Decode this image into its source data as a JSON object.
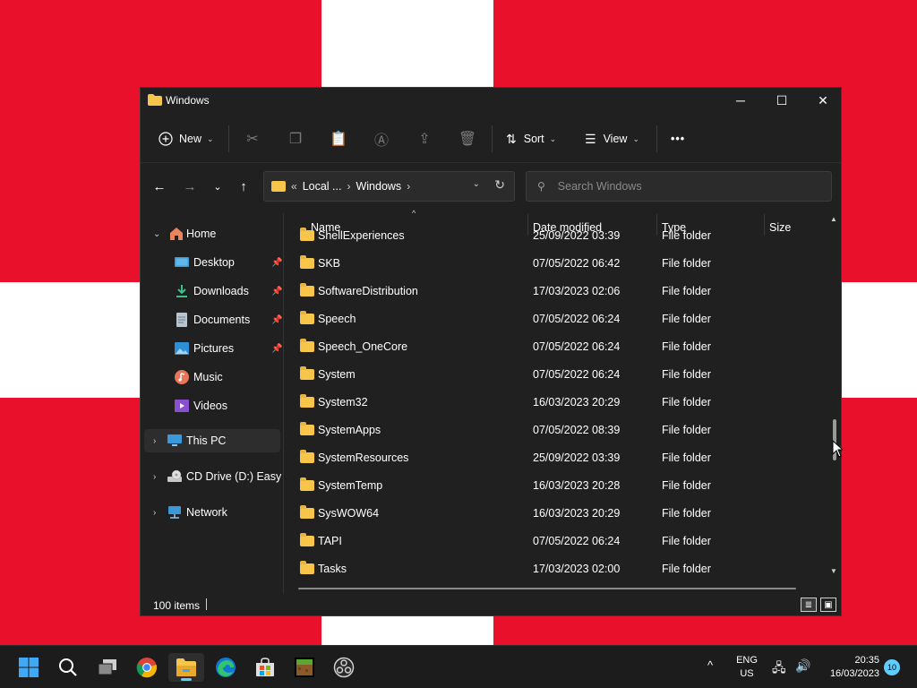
{
  "window": {
    "title": "Windows"
  },
  "toolbar": {
    "new_label": "New",
    "sort_label": "Sort",
    "view_label": "View",
    "more_label": "•••"
  },
  "address": {
    "overflow": "«",
    "parts": [
      "Local ...",
      "Windows"
    ]
  },
  "search": {
    "placeholder": "Search Windows"
  },
  "sidebar": {
    "items": [
      {
        "label": "Home",
        "icon": "home-icon"
      },
      {
        "label": "Desktop",
        "icon": "desktop-icon",
        "pinned": true
      },
      {
        "label": "Downloads",
        "icon": "download-icon",
        "pinned": true
      },
      {
        "label": "Documents",
        "icon": "document-icon",
        "pinned": true
      },
      {
        "label": "Pictures",
        "icon": "pictures-icon",
        "pinned": true
      },
      {
        "label": "Music",
        "icon": "music-icon"
      },
      {
        "label": "Videos",
        "icon": "videos-icon"
      },
      {
        "label": "This PC",
        "icon": "pc-icon",
        "selected": true
      },
      {
        "label": "CD Drive (D:) EasyKMS",
        "icon": "cd-drive-icon"
      },
      {
        "label": "Network",
        "icon": "network-icon"
      }
    ]
  },
  "columns": {
    "name": "Name",
    "date": "Date modified",
    "type": "Type",
    "size": "Size"
  },
  "files": [
    {
      "name": "ShellExperiences",
      "date": "25/09/2022 03:39",
      "type": "File folder"
    },
    {
      "name": "SKB",
      "date": "07/05/2022 06:42",
      "type": "File folder"
    },
    {
      "name": "SoftwareDistribution",
      "date": "17/03/2023 02:06",
      "type": "File folder"
    },
    {
      "name": "Speech",
      "date": "07/05/2022 06:24",
      "type": "File folder"
    },
    {
      "name": "Speech_OneCore",
      "date": "07/05/2022 06:24",
      "type": "File folder"
    },
    {
      "name": "System",
      "date": "07/05/2022 06:24",
      "type": "File folder"
    },
    {
      "name": "System32",
      "date": "16/03/2023 20:29",
      "type": "File folder"
    },
    {
      "name": "SystemApps",
      "date": "07/05/2022 08:39",
      "type": "File folder"
    },
    {
      "name": "SystemResources",
      "date": "25/09/2022 03:39",
      "type": "File folder"
    },
    {
      "name": "SystemTemp",
      "date": "16/03/2023 20:28",
      "type": "File folder"
    },
    {
      "name": "SysWOW64",
      "date": "16/03/2023 20:29",
      "type": "File folder"
    },
    {
      "name": "TAPI",
      "date": "07/05/2022 06:24",
      "type": "File folder"
    },
    {
      "name": "Tasks",
      "date": "17/03/2023 02:00",
      "type": "File folder"
    }
  ],
  "status": {
    "item_count": "100 items"
  },
  "taskbar": {
    "lang_top": "ENG",
    "lang_bottom": "US",
    "time": "20:35",
    "date": "16/03/2023",
    "notifications": "10"
  },
  "colors": {
    "wallpaper_red": "#e8102a",
    "folder_yellow": "#f6c54a",
    "accent": "#60cdff"
  }
}
